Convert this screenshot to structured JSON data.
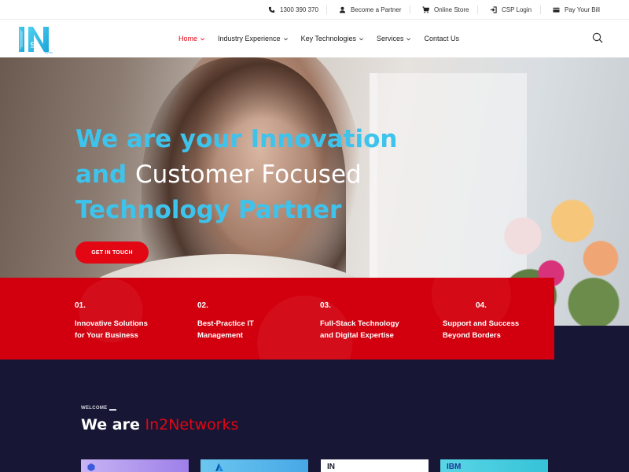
{
  "topbar": {
    "phone": "1300 390 370",
    "partner": "Become a Partner",
    "store": "Online Store",
    "csp": "CSP Login",
    "pay": "Pay Your Bill"
  },
  "logo": {
    "text": "IN",
    "sub": "2"
  },
  "nav": {
    "items": [
      {
        "label": "Home",
        "active": true,
        "dropdown": true
      },
      {
        "label": "Industry Experience",
        "active": false,
        "dropdown": true
      },
      {
        "label": "Key Technologies",
        "active": false,
        "dropdown": true
      },
      {
        "label": "Services",
        "active": false,
        "dropdown": true
      },
      {
        "label": "Contact Us",
        "active": false,
        "dropdown": false
      }
    ],
    "search_icon": "search-icon"
  },
  "hero": {
    "line1": "We are your Innovation",
    "line2_hl": "and",
    "line2_rest": "Customer Focused",
    "line3": "Technology Partner",
    "cta": "GET IN TOUCH"
  },
  "features": [
    {
      "num": "01.",
      "line1": "Innovative Solutions",
      "line2": "for Your Business"
    },
    {
      "num": "02.",
      "line1": "Best-Practice IT",
      "line2": "Management"
    },
    {
      "num": "03.",
      "line1": "Full-Stack Technology",
      "line2": "and Digital Expertise"
    },
    {
      "num": "04.",
      "line1": "Support and Success",
      "line2": "Beyond Borders"
    }
  ],
  "welcome": {
    "eyebrow": "WELCOME",
    "heading_prefix": "We are",
    "heading_brand": "In2Networks"
  },
  "cards": [
    {
      "label": ""
    },
    {
      "label": ""
    },
    {
      "label": "IN"
    },
    {
      "label": "IBM"
    }
  ],
  "colors": {
    "accent_red": "#e30613",
    "accent_blue": "#3ec3ec",
    "dark_navy": "#171634"
  }
}
